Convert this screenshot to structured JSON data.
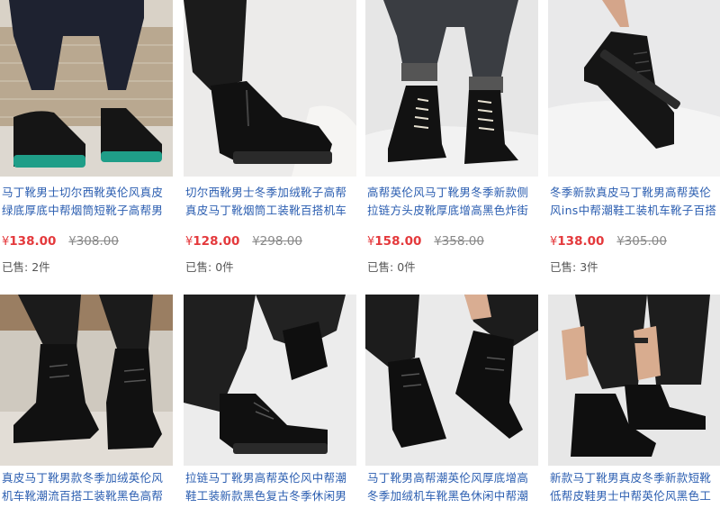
{
  "products": [
    {
      "title": "马丁靴男士切尔西靴英伦风真皮绿底厚底中帮烟筒短靴子高帮男",
      "currency": "¥",
      "price": "138.00",
      "original_price": "308.00",
      "sold_label": "已售:",
      "sold_count": "2件",
      "image": "boots-green-sole-photo"
    },
    {
      "title": "切尔西靴男士冬季加绒靴子高帮真皮马丁靴烟筒工装靴百搭机车",
      "currency": "¥",
      "price": "128.00",
      "original_price": "298.00",
      "sold_label": "已售:",
      "sold_count": "0件",
      "image": "chelsea-boot-photo"
    },
    {
      "title": "高帮英伦风马丁靴男冬季新款侧拉链方头皮靴厚底增高黑色炸街",
      "currency": "¥",
      "price": "158.00",
      "original_price": "358.00",
      "sold_label": "已售:",
      "sold_count": "0件",
      "image": "lace-up-boots-white-laces-photo"
    },
    {
      "title": "冬季新款真皮马丁靴男高帮英伦风ins中帮潮鞋工装机车靴子百搭",
      "currency": "¥",
      "price": "138.00",
      "original_price": "305.00",
      "sold_label": "已售:",
      "sold_count": "3件",
      "image": "boot-held-by-hand-photo"
    },
    {
      "title": "真皮马丁靴男款冬季加绒英伦风机车靴潮流百搭工装靴黑色高帮",
      "image": "boots-outdoor-photo"
    },
    {
      "title": "拉链马丁靴男高帮英伦风中帮潮鞋工装新款黑色复古冬季休闲男",
      "image": "boots-on-white-cloth-photo"
    },
    {
      "title": "马丁靴男高帮潮英伦风厚底增高冬季加绒机车靴黑色休闲中帮潮",
      "image": "boots-pulling-pants-photo"
    },
    {
      "title": "新款马丁靴男真皮冬季新款短靴低帮皮鞋男士中帮英伦风黑色工",
      "image": "boots-rolling-pants-photo"
    }
  ]
}
